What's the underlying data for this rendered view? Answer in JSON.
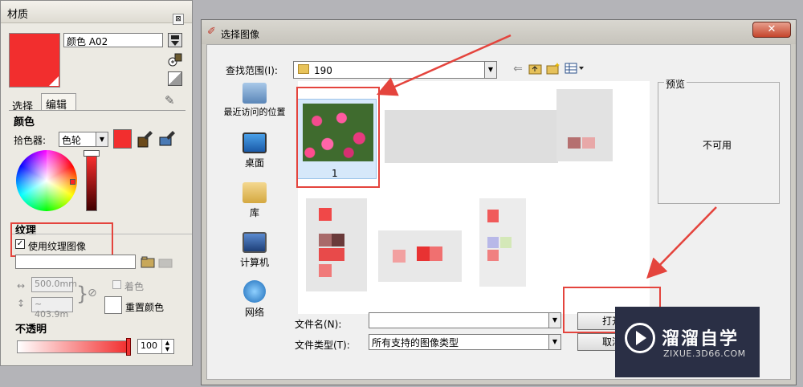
{
  "material_panel": {
    "title": "材质",
    "close_glyph": "⊠",
    "material_name": "颜色 A02",
    "tabs": {
      "select": "选择",
      "edit": "编辑"
    },
    "color_section": "颜色",
    "picker_label": "拾色器:",
    "picker_value": "色轮",
    "texture_section": "纹理",
    "use_texture_label": "使用纹理图像",
    "width_value": "500.0mm",
    "height_value": "~ 403.9m",
    "tint_label": "着色",
    "reset_color_label": "重置颜色",
    "opacity_section": "不透明",
    "opacity_value": "100",
    "swatch_color": "#f22e2e"
  },
  "dialog": {
    "title": "选择图像",
    "close_glyph": "✕",
    "lookin_label": "查找范围(I):",
    "lookin_value": "190",
    "places": [
      {
        "label": "最近访问的位置",
        "icon": "recent-places-icon"
      },
      {
        "label": "桌面",
        "icon": "desktop-icon"
      },
      {
        "label": "库",
        "icon": "library-icon"
      },
      {
        "label": "计算机",
        "icon": "computer-icon"
      },
      {
        "label": "网络",
        "icon": "network-icon"
      }
    ],
    "files": [
      {
        "label": "1"
      }
    ],
    "preview_title": "预览",
    "preview_text": "不可用",
    "filename_label": "文件名(N):",
    "filename_value": "",
    "filetype_label": "文件类型(T):",
    "filetype_value": "所有支持的图像类型",
    "open_button": "打开",
    "cancel_button": "取消"
  },
  "watermark": {
    "name": "溜溜自学",
    "url": "ZIXUE.3D66.COM"
  },
  "colors": {
    "annotation_red": "#e4443d",
    "dialog_close": "#c4452c",
    "watermark_bg": "#2a2f45"
  }
}
